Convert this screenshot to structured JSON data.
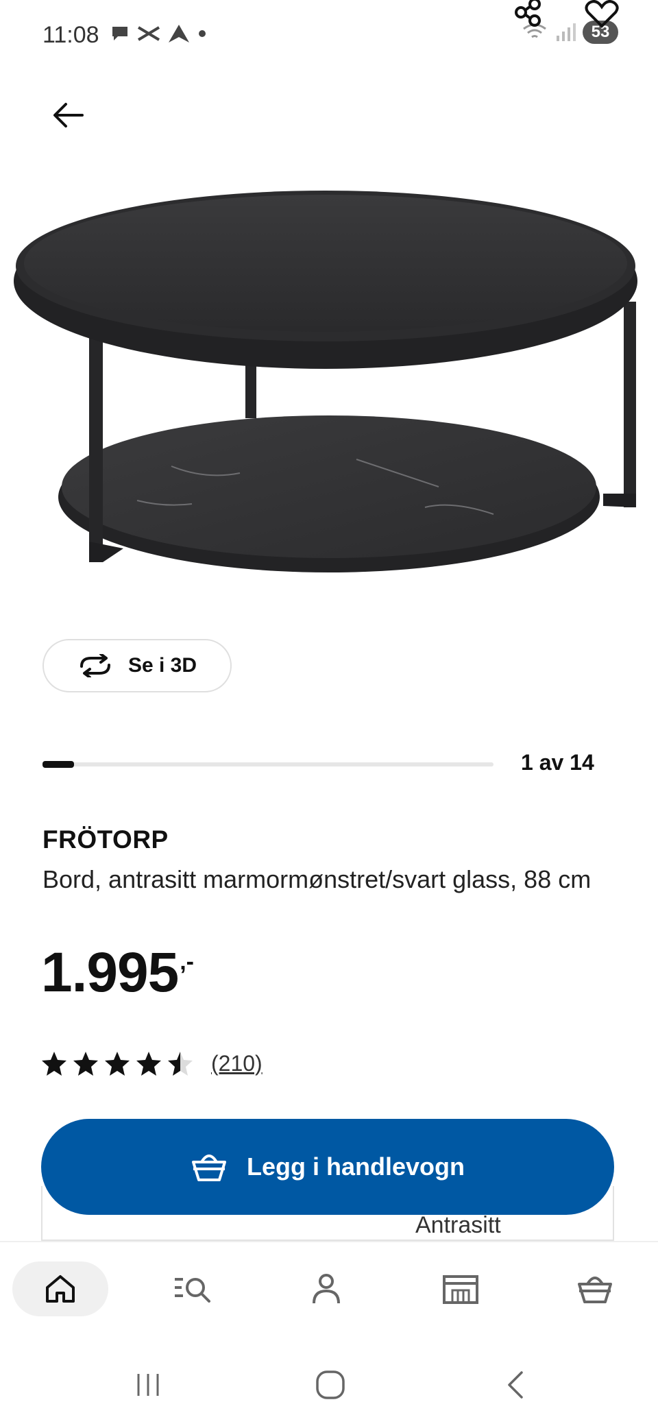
{
  "status_bar": {
    "time": "11:08",
    "battery": "53"
  },
  "product": {
    "view_3d_label": "Se i 3D",
    "image_index_text": "1 av 14",
    "image_progress": 0.07,
    "name": "FRÖTORP",
    "description": "Bord, antrasitt marmormønstret/svart glass, 88 cm",
    "price_main": "1.995",
    "price_suffix": ",-",
    "rating_value": 4.5,
    "rating_max": 5,
    "review_count": "(210)",
    "add_to_cart_label": "Legg i handlevogn",
    "variant_color": "Antrasitt"
  },
  "colors": {
    "primary_blue": "#0058a3",
    "text_dark": "#111111"
  },
  "bottom_nav": {
    "items": [
      "home-icon",
      "search-list-icon",
      "profile-icon",
      "store-icon",
      "cart-basket-icon"
    ],
    "active": "home-icon"
  }
}
